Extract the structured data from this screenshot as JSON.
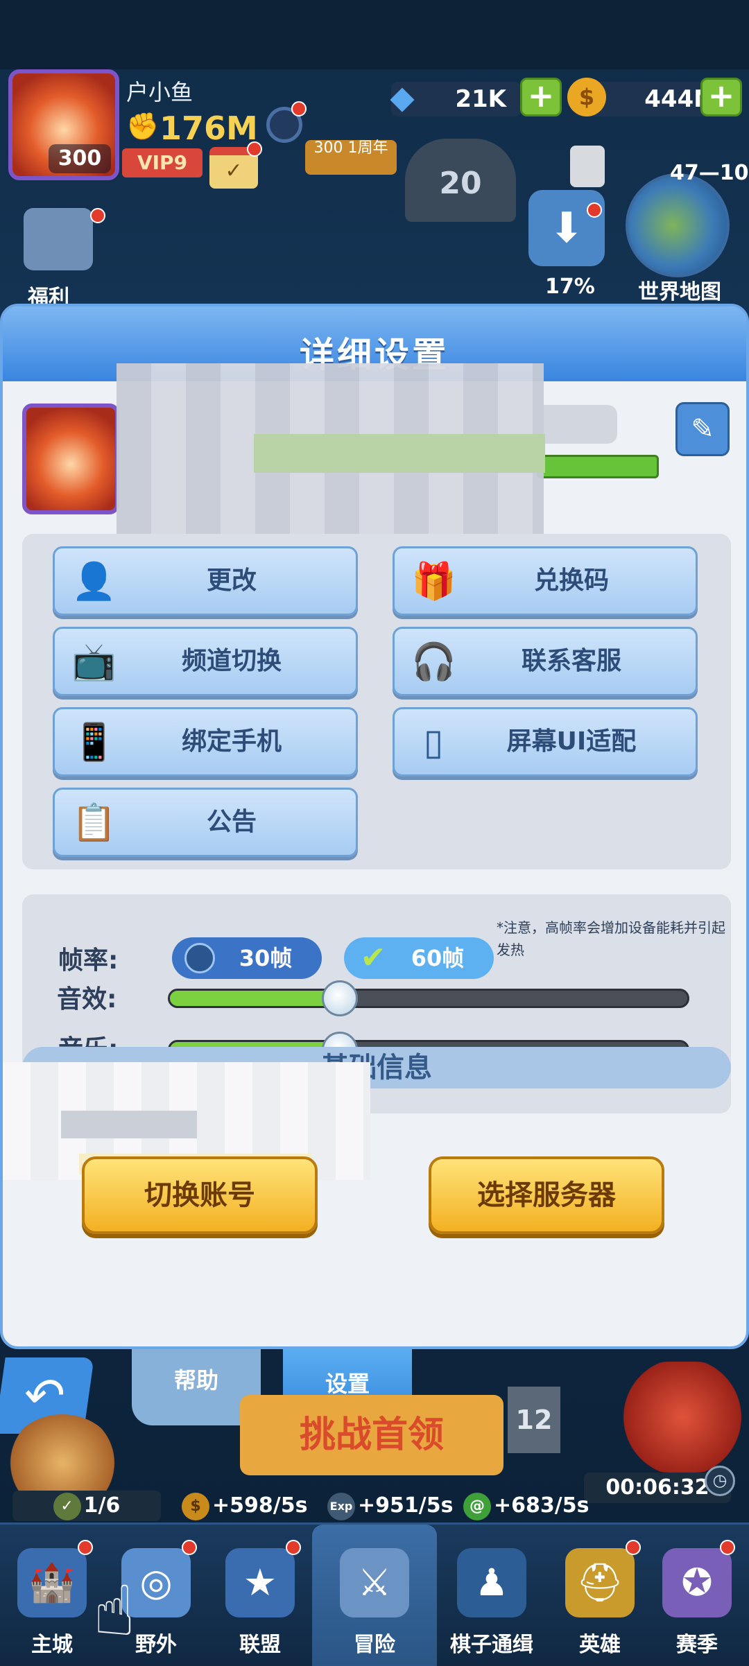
{
  "hud": {
    "player_name": "户小鱼",
    "player_level": "300",
    "power": "176M",
    "vip": "VIP9",
    "gems": "21K",
    "gold": "444M",
    "welfare_label": "福利",
    "download_pct": "17%",
    "world_map_label": "世界地图",
    "world_level": "47—10",
    "castle_level": "20",
    "banner_text": "300 1周年"
  },
  "modal": {
    "title": "详细设置",
    "buttons": [
      {
        "label": "更改",
        "icon": "person-icon"
      },
      {
        "label": "兑换码",
        "icon": "gift-icon"
      },
      {
        "label": "频道切换",
        "icon": "tv-icon"
      },
      {
        "label": "联系客服",
        "icon": "headset-icon"
      },
      {
        "label": "绑定手机",
        "icon": "phone-icon"
      },
      {
        "label": "屏幕UI适配",
        "icon": "screen-adapt-icon"
      },
      {
        "label": "公告",
        "icon": "notice-board-icon"
      }
    ],
    "framerate": {
      "label": "帧率:",
      "option_30": "30帧",
      "option_60": "60帧",
      "selected": "60帧",
      "note": "*注意，高帧率会增加设备能耗并引起发热"
    },
    "sound": {
      "label": "音效:",
      "level": 0.33
    },
    "music": {
      "label": "音乐:",
      "level": 0.33
    },
    "basic_info_header": "基础信息",
    "switch_account": "切换账号",
    "select_server": "选择服务器"
  },
  "bottom_tabs": {
    "help": "帮助",
    "settings": "设置"
  },
  "game": {
    "boss_button": "挑战首领",
    "stage_level": "12",
    "timer": "00:06:32",
    "progress": "1/6",
    "gold_rate": "+598/5s",
    "exp_rate": "+951/5s",
    "green_rate": "+683/5s"
  },
  "nav": [
    {
      "label": "主城",
      "icon": "castle-icon"
    },
    {
      "label": "野外",
      "icon": "portal-icon"
    },
    {
      "label": "联盟",
      "icon": "shield-star-icon"
    },
    {
      "label": "冒险",
      "icon": "sword-icon"
    },
    {
      "label": "棋子通缉",
      "icon": "chess-figure-icon"
    },
    {
      "label": "英雄",
      "icon": "helmet-icon"
    },
    {
      "label": "赛季",
      "icon": "star-badge-icon"
    }
  ],
  "colors": {
    "accent_blue": "#3a85e0",
    "slider_green": "#7bd13f",
    "gold_button": "#f3b022",
    "alert_red": "#e23a2b"
  }
}
